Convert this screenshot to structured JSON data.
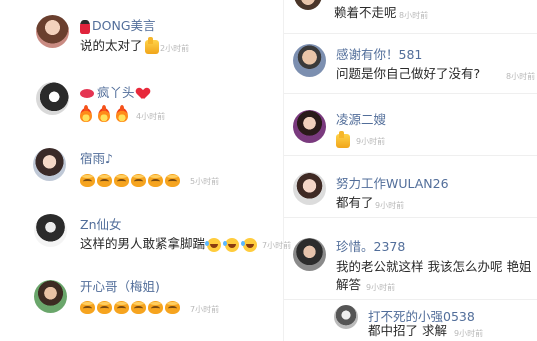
{
  "left_comments": [
    {
      "username": "DONG美言",
      "name_prefix_icon": "dancer-emoji",
      "text": "说的太对了",
      "emojis": [
        "thumbs-up-emoji"
      ],
      "time": "2小时前"
    },
    {
      "username": "疯丫头",
      "name_prefix_icon": "lips-emoji",
      "name_suffix_icon": "heart-emoji",
      "text": "",
      "emojis": [
        "fire-emoji",
        "fire-emoji",
        "fire-emoji"
      ],
      "time": "4小时前"
    },
    {
      "username": "宿雨♪",
      "text": "",
      "emojis": [
        "cute-face-emoji",
        "cute-face-emoji",
        "cute-face-emoji",
        "cute-face-emoji",
        "cute-face-emoji",
        "cute-face-emoji"
      ],
      "time": "5小时前"
    },
    {
      "username": "Zn仙女",
      "text": "这样的男人敢紧拿脚踹",
      "emojis": [
        "laugh-emoji",
        "laugh-emoji",
        "laugh-emoji"
      ],
      "time": "7小时前"
    },
    {
      "username": "开心哥（梅姐)",
      "text": "",
      "emojis": [
        "cute-face-emoji",
        "cute-face-emoji",
        "cute-face-emoji",
        "cute-face-emoji",
        "cute-face-emoji",
        "cute-face-emoji"
      ],
      "time": "7小时前"
    }
  ],
  "right_comments": [
    {
      "username": "",
      "text": "赖着不走呢",
      "time": "8小时前"
    },
    {
      "username": "感谢有你！581",
      "text": "问题是你自己做好了没有?",
      "time": "8小时前"
    },
    {
      "username": "凌源二嫂",
      "text": "",
      "emojis": [
        "thumbs-up-emoji"
      ],
      "time": "9小时前"
    },
    {
      "username": "努力工作WULAN26",
      "text": "都有了",
      "time": "9小时前"
    },
    {
      "username": "珍惜。2378",
      "text_line1": "我的老公就这样  我该怎么办呢  艳姐",
      "text_line2": "解答",
      "time": "9小时前"
    },
    {
      "username": "打不死的小强0538",
      "text": "都中招了  求解",
      "time": "9小时前"
    }
  ]
}
